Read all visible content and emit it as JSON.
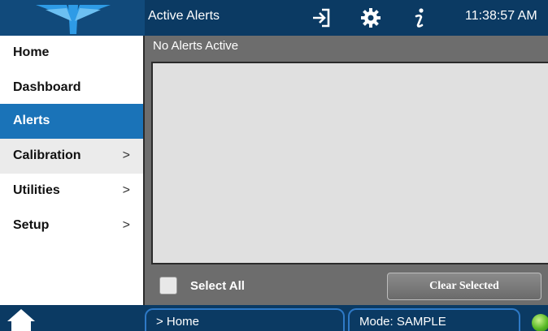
{
  "header": {
    "title": "Active Alerts",
    "time": "11:38:57 AM",
    "icons": [
      "login-icon",
      "gear-icon",
      "info-icon"
    ]
  },
  "sidebar": {
    "items": [
      {
        "label": "Home",
        "chevron": false
      },
      {
        "label": "Dashboard",
        "chevron": false
      },
      {
        "label": "Alerts",
        "chevron": false,
        "active": true
      },
      {
        "label": "Calibration",
        "chevron": true
      },
      {
        "label": "Utilities",
        "chevron": true
      },
      {
        "label": "Setup",
        "chevron": true
      }
    ],
    "chevron_glyph": ">"
  },
  "main": {
    "status": "No Alerts Active",
    "select_all_label": "Select All",
    "clear_button_label": "Clear Selected"
  },
  "footer": {
    "breadcrumb": "> Home",
    "mode": "Mode: SAMPLE"
  },
  "colors": {
    "header_bg": "#0b3a63",
    "active_item": "#1a73b8",
    "panel_bg": "#6d6d6d",
    "status_ok": "#58b825"
  }
}
